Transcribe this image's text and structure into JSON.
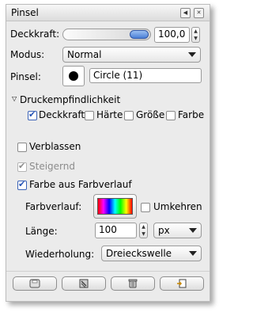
{
  "window": {
    "title": "Pinsel"
  },
  "opacity": {
    "label": "Deckkraft:",
    "value": "100,0",
    "level": 1.0
  },
  "mode": {
    "label": "Modus:",
    "value": "Normal"
  },
  "brush": {
    "label": "Pinsel:",
    "name": "Circle (11)"
  },
  "pressure": {
    "header": "Druckempfindlichkeit",
    "items": [
      {
        "label": "Deckkraft",
        "checked": true
      },
      {
        "label": "Härte",
        "checked": false
      },
      {
        "label": "Größe",
        "checked": false
      },
      {
        "label": "Farbe",
        "checked": false
      }
    ]
  },
  "fade": {
    "label": "Verblassen",
    "checked": false
  },
  "incremental": {
    "label": "Steigernd",
    "checked": true,
    "disabled": true
  },
  "gradient_color": {
    "label": "Farbe aus Farbverlauf",
    "checked": true
  },
  "gradient": {
    "label": "Farbverlauf:",
    "reverse_label": "Umkehren",
    "reverse_checked": false
  },
  "length": {
    "label": "Länge:",
    "value": "100",
    "unit": "px"
  },
  "repeat": {
    "label": "Wiederholung:",
    "value": "Dreieckswelle"
  },
  "toolbar": {
    "buttons": [
      "save-icon",
      "restore-icon",
      "delete-icon",
      "reset-icon"
    ]
  }
}
